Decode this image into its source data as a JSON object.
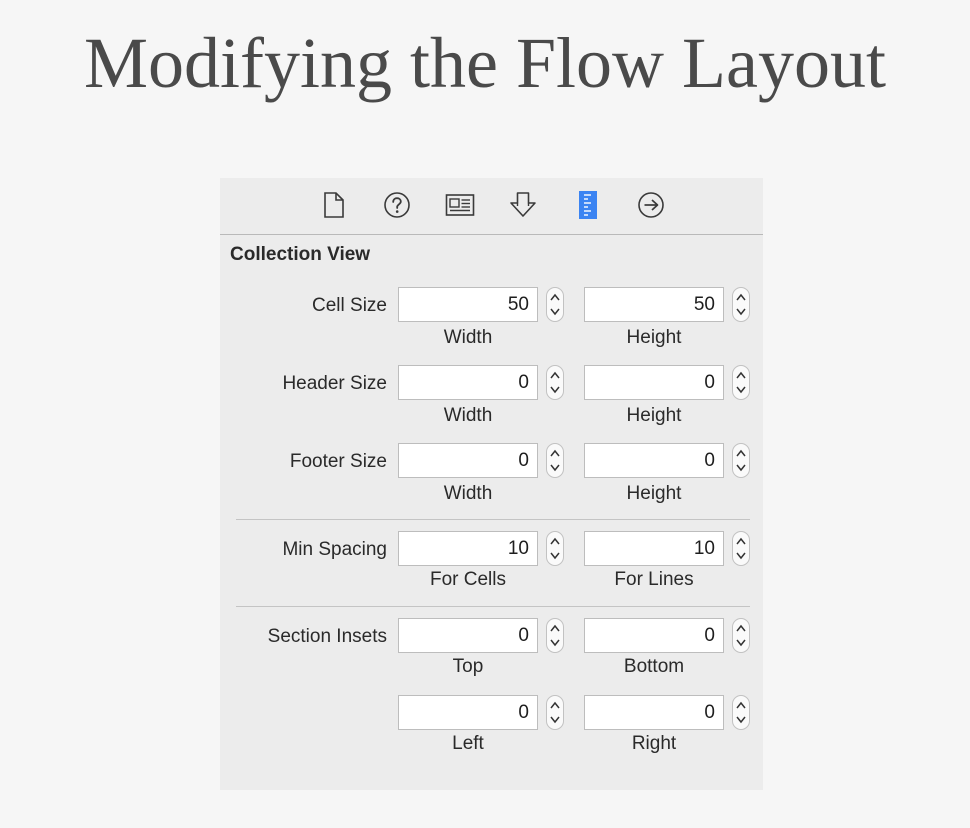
{
  "slide": {
    "title": "Modifying the Flow Layout"
  },
  "inspector": {
    "toolbar_icons": [
      "file-icon",
      "help-icon",
      "identity-icon",
      "attributes-icon",
      "size-ruler-icon",
      "connections-icon"
    ],
    "active_icon": "size-ruler-icon",
    "accent_color": "#3b84f2",
    "section_title": "Collection View",
    "cell_size": {
      "label": "Cell Size",
      "width": "50",
      "height": "50",
      "width_label": "Width",
      "height_label": "Height"
    },
    "header_size": {
      "label": "Header Size",
      "width": "0",
      "height": "0",
      "width_label": "Width",
      "height_label": "Height"
    },
    "footer_size": {
      "label": "Footer Size",
      "width": "0",
      "height": "0",
      "width_label": "Width",
      "height_label": "Height"
    },
    "min_spacing": {
      "label": "Min Spacing",
      "cells": "10",
      "lines": "10",
      "cells_label": "For Cells",
      "lines_label": "For Lines"
    },
    "section_insets": {
      "label": "Section Insets",
      "top": "0",
      "bottom": "0",
      "left": "0",
      "right": "0",
      "top_label": "Top",
      "bottom_label": "Bottom",
      "left_label": "Left",
      "right_label": "Right"
    }
  }
}
